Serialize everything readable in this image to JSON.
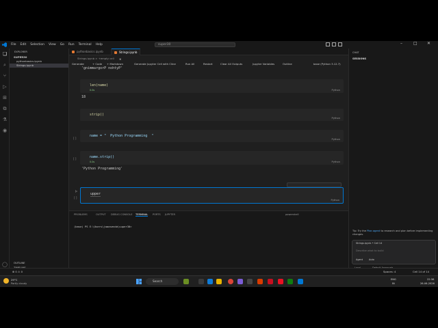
{
  "menu": [
    "File",
    "Edit",
    "Selection",
    "View",
    "Go",
    "Run",
    "Terminal",
    "Help"
  ],
  "search_box": "super30",
  "explorer": {
    "title": "EXPLORER",
    "folder": "SUPER30",
    "files": [
      "pythonbasics.ipynb",
      "Strings.ipynb"
    ],
    "outline": "OUTLINE",
    "timeline": "TIMELINE"
  },
  "tabs": [
    {
      "label": "pythonbasics.ipynb"
    },
    {
      "label": "Strings.ipynb",
      "close": "×"
    }
  ],
  "breadcrumb": "Strings.ipynb > +empty cell",
  "toolbar": {
    "generate": "Generate",
    "code": "+ Code",
    "markdown": "+ Markdown",
    "jupyter_generate": "Generate Jupyter Cell with Cline",
    "run_all": "Run All",
    "restart": "Restart",
    "clear": "Clear All Outputs",
    "variables": "Jupyter Variables",
    "outline": "Outline",
    "kernel": "base (Python 3.12.7)"
  },
  "cells": [
    {
      "code_top": "'gnimmargorP nohtyP'"
    },
    {
      "code": "len(name)",
      "time": "0.0s",
      "lang": "Python",
      "output": "18"
    },
    {
      "code": "strip()",
      "lang": "Python"
    },
    {
      "code": "name = \"  Python Programming  \"",
      "lang": "Python",
      "bracket": "[ ]"
    },
    {
      "code": "name.strip()",
      "time": "0.0s",
      "lang": "Python",
      "output": "'Python Programming'",
      "bracket": "[ ]"
    },
    {
      "code": "upper",
      "lang": "Python",
      "bracket": "[ ]"
    }
  ],
  "panel": {
    "tabs": [
      "PROBLEMS",
      "OUTPUT",
      "DEBUG CONSOLE",
      "TERMINAL",
      "PORTS",
      "JUPYTER"
    ],
    "active": "TERMINAL",
    "shell": "powershell",
    "prompt": "(base) PS E:\\Users\\jaaasenda\\super30>"
  },
  "chat": {
    "title": "CHAT",
    "sessions": "SESSIONS",
    "tip_prefix": "Tip: Try the",
    "tip_link": "Plan agent",
    "tip_suffix": "to research and plan before implementing changes.",
    "context": "Strings.ipynb • Cell 14",
    "placeholder": "Describe what to build",
    "agent": "Agent",
    "auto": "Auto",
    "local": "Local",
    "default_approvals": "Default Approvals"
  },
  "status": {
    "left": "⊗ 0  ⚠ 0",
    "spaces": "Spaces: 4",
    "cell": "Cell 14 of 14"
  },
  "taskbar": {
    "temp": "29°C",
    "weather": "Partly cloudy",
    "search": "Search",
    "lang": "ENG",
    "lang2": "IN",
    "time": "22:36",
    "date": "26-06-2026"
  }
}
